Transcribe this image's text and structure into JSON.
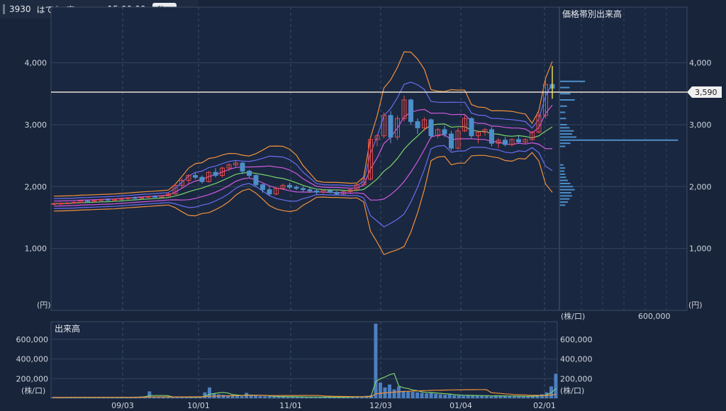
{
  "header": {
    "code": "3930",
    "name": "はてな",
    "market": "東マ",
    "time": "15:00:00",
    "info_icon": "info-icon"
  },
  "chart_data": [
    {
      "type": "candlestick",
      "subtitle": "価格帯別出来高",
      "y_unit": "(円)",
      "x_unit": "(株/口)",
      "ylim": [
        0,
        4900
      ],
      "yticks": [
        "1,000",
        "2,000",
        "3,000",
        "4,000"
      ],
      "volume_profile_ticks": [
        "600,000"
      ],
      "last_price": "3,590",
      "candles": [
        [
          1720,
          1740,
          1700,
          1725
        ],
        [
          1725,
          1745,
          1705,
          1730
        ],
        [
          1730,
          1750,
          1715,
          1735
        ],
        [
          1735,
          1760,
          1720,
          1745
        ],
        [
          1745,
          1780,
          1730,
          1770
        ],
        [
          1770,
          1790,
          1750,
          1760
        ],
        [
          1760,
          1785,
          1740,
          1775
        ],
        [
          1775,
          1800,
          1760,
          1790
        ],
        [
          1790,
          1810,
          1770,
          1780
        ],
        [
          1780,
          1800,
          1760,
          1795
        ],
        [
          1795,
          1820,
          1780,
          1805
        ],
        [
          1805,
          1830,
          1790,
          1820
        ],
        [
          1820,
          1840,
          1800,
          1810
        ],
        [
          1810,
          1830,
          1790,
          1825
        ],
        [
          1825,
          1850,
          1810,
          1840
        ],
        [
          1840,
          1860,
          1820,
          1830
        ],
        [
          1830,
          1860,
          1815,
          1850
        ],
        [
          1850,
          1900,
          1840,
          1880
        ],
        [
          1880,
          2050,
          1870,
          2020
        ],
        [
          2020,
          2130,
          1980,
          2100
        ],
        [
          2100,
          2200,
          2050,
          2180
        ],
        [
          2180,
          2230,
          2120,
          2150
        ],
        [
          2150,
          2180,
          2050,
          2080
        ],
        [
          2080,
          2250,
          2070,
          2230
        ],
        [
          2230,
          2300,
          2150,
          2180
        ],
        [
          2180,
          2320,
          2150,
          2300
        ],
        [
          2300,
          2380,
          2250,
          2350
        ],
        [
          2350,
          2420,
          2300,
          2380
        ],
        [
          2380,
          2400,
          2200,
          2250
        ],
        [
          2250,
          2270,
          2150,
          2180
        ],
        [
          2180,
          2200,
          2000,
          2030
        ],
        [
          2030,
          2050,
          1900,
          1950
        ],
        [
          1950,
          2000,
          1850,
          1880
        ],
        [
          1880,
          1990,
          1860,
          1970
        ],
        [
          1970,
          2050,
          1950,
          2020
        ],
        [
          2020,
          2060,
          1960,
          1990
        ],
        [
          1990,
          2020,
          1940,
          1970
        ],
        [
          1970,
          2000,
          1920,
          1950
        ],
        [
          1950,
          1980,
          1900,
          1930
        ],
        [
          1930,
          1960,
          1880,
          1910
        ],
        [
          1910,
          1950,
          1870,
          1935
        ],
        [
          1935,
          1960,
          1890,
          1905
        ],
        [
          1905,
          1930,
          1860,
          1880
        ],
        [
          1880,
          1940,
          1860,
          1920
        ],
        [
          1920,
          1960,
          1900,
          1950
        ],
        [
          1950,
          2050,
          1940,
          2030
        ],
        [
          2030,
          2150,
          2010,
          2120
        ],
        [
          2120,
          2780,
          2100,
          2760
        ],
        [
          2760,
          2850,
          2650,
          2820
        ],
        [
          2820,
          3200,
          2780,
          3150
        ],
        [
          3150,
          3220,
          2700,
          2800
        ],
        [
          2800,
          3150,
          2750,
          3100
        ],
        [
          3100,
          3470,
          3050,
          3400
        ],
        [
          3400,
          3420,
          3000,
          3050
        ],
        [
          3050,
          3100,
          2850,
          2950
        ],
        [
          2950,
          3120,
          2900,
          3080
        ],
        [
          3080,
          3100,
          2780,
          2820
        ],
        [
          2820,
          2950,
          2780,
          2920
        ],
        [
          2920,
          2980,
          2800,
          2850
        ],
        [
          2850,
          2900,
          2580,
          2620
        ],
        [
          2620,
          2950,
          2600,
          2900
        ],
        [
          2900,
          3150,
          2880,
          3100
        ],
        [
          3100,
          3120,
          2780,
          2820
        ],
        [
          2820,
          2900,
          2700,
          2880
        ],
        [
          2880,
          2950,
          2820,
          2920
        ],
        [
          2920,
          2960,
          2650,
          2700
        ],
        [
          2700,
          2780,
          2620,
          2750
        ],
        [
          2750,
          2800,
          2650,
          2680
        ],
        [
          2680,
          2780,
          2650,
          2760
        ],
        [
          2760,
          2820,
          2700,
          2720
        ],
        [
          2720,
          2780,
          2680,
          2760
        ],
        [
          2760,
          2900,
          2740,
          2880
        ],
        [
          2880,
          3200,
          2860,
          3150
        ],
        [
          3150,
          3720,
          3100,
          3650
        ],
        [
          3650,
          3950,
          3420,
          3590
        ]
      ],
      "bollinger_colors": {
        "ma": "#7ad46a",
        "s1": "#d05be0",
        "s2": "#6a6ef0",
        "s3": "#f0913c"
      },
      "volume_profile": [
        [
          1700,
          60
        ],
        [
          1750,
          90
        ],
        [
          1800,
          110
        ],
        [
          1850,
          140
        ],
        [
          1900,
          130
        ],
        [
          1950,
          170
        ],
        [
          2000,
          150
        ],
        [
          2050,
          120
        ],
        [
          2100,
          90
        ],
        [
          2150,
          70
        ],
        [
          2200,
          60
        ],
        [
          2250,
          50
        ],
        [
          2300,
          60
        ],
        [
          2350,
          40
        ],
        [
          2650,
          60
        ],
        [
          2700,
          120
        ],
        [
          2750,
          1370
        ],
        [
          2800,
          190
        ],
        [
          2850,
          140
        ],
        [
          2900,
          160
        ],
        [
          2950,
          110
        ],
        [
          3000,
          80
        ],
        [
          3100,
          70
        ],
        [
          3200,
          60
        ],
        [
          3300,
          80
        ],
        [
          3400,
          170
        ],
        [
          3500,
          120
        ],
        [
          3600,
          110
        ],
        [
          3700,
          290
        ]
      ]
    },
    {
      "type": "bar",
      "title": "出来高",
      "y_unit": "(株/口)",
      "yticks": [
        "200,000",
        "400,000",
        "600,000"
      ],
      "ylim": [
        0,
        780000
      ],
      "x_tick_labels": [
        "09/03",
        "10/01",
        "11/01",
        "12/03",
        "01/04",
        "02/01"
      ],
      "values": [
        8000,
        9000,
        7000,
        10000,
        12000,
        9000,
        8000,
        11000,
        9000,
        10000,
        8000,
        12000,
        9000,
        10000,
        8000,
        11000,
        9000,
        14000,
        12000,
        16000,
        20000,
        70000,
        18000,
        15000,
        14000,
        12000,
        10000,
        9000,
        15000,
        12000,
        11000,
        10000,
        13000,
        60000,
        110000,
        50000,
        40000,
        35000,
        30000,
        32000,
        25000,
        20000,
        55000,
        30000,
        25000,
        22000,
        20000,
        18000,
        16000,
        15000,
        18000,
        14000,
        12000,
        13000,
        12000,
        11000,
        15000,
        12000,
        11000,
        10000,
        12000,
        11000,
        10000,
        12000,
        14000,
        13000,
        15000,
        20000,
        25000,
        30000,
        760000,
        160000,
        110000,
        140000,
        90000,
        120000,
        75000,
        70000,
        65000,
        60000,
        55000,
        50000,
        60000,
        45000,
        40000,
        35000,
        38000,
        30000,
        28000,
        25000,
        32000,
        28000,
        26000,
        24000,
        22000,
        20000,
        30000,
        25000,
        22000,
        20000,
        19000,
        18000,
        20000,
        22000,
        25000,
        30000,
        40000,
        60000,
        120000,
        250000
      ],
      "ma_colors": {
        "short": "#7ad46a",
        "long": "#f0913c"
      }
    }
  ]
}
